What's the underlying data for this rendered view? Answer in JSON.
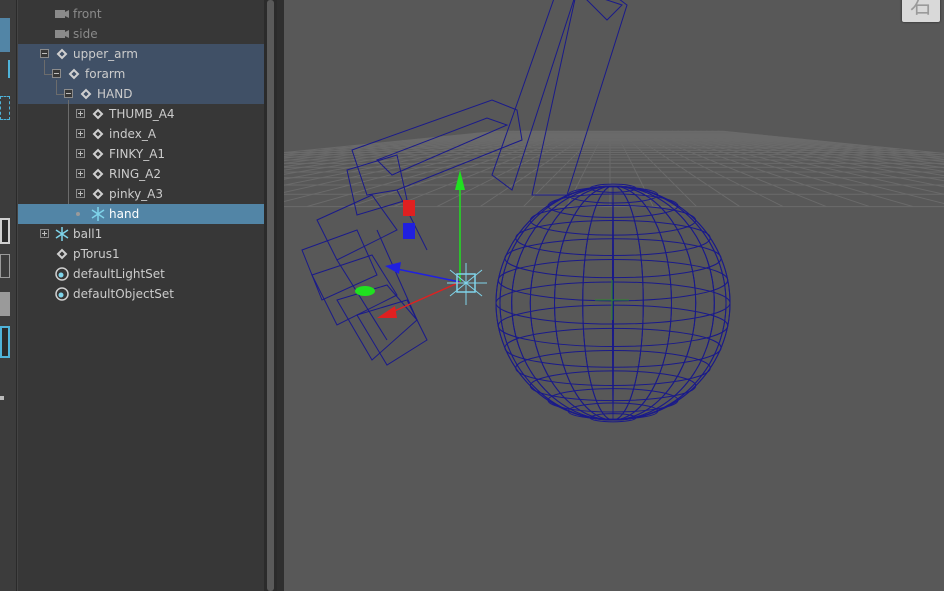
{
  "outliner": {
    "items": [
      {
        "label": "front",
        "icon": "camera-icon"
      },
      {
        "label": "side",
        "icon": "camera-icon"
      },
      {
        "label": "upper_arm",
        "icon": "joint-icon"
      },
      {
        "label": "forarm",
        "icon": "joint-icon"
      },
      {
        "label": "HAND",
        "icon": "joint-icon"
      },
      {
        "label": "THUMB_A4",
        "icon": "joint-icon"
      },
      {
        "label": "index_A",
        "icon": "joint-icon"
      },
      {
        "label": "FINKY_A1",
        "icon": "joint-icon"
      },
      {
        "label": "RING_A2",
        "icon": "joint-icon"
      },
      {
        "label": "pinky_A3",
        "icon": "joint-icon"
      },
      {
        "label": "hand",
        "icon": "ik-handle-icon"
      },
      {
        "label": "ball1",
        "icon": "ik-handle-icon"
      },
      {
        "label": "pTorus1",
        "icon": "joint-icon"
      },
      {
        "label": "defaultLightSet",
        "icon": "set-icon"
      },
      {
        "label": "defaultObjectSet",
        "icon": "set-icon"
      }
    ]
  },
  "viewport": {
    "viewcube_label": "右",
    "wire_color": "#1a1a8a",
    "grid_color": "#6a6a6a",
    "axis_colors": {
      "x": "#e02020",
      "y": "#20e020",
      "z": "#2020e0"
    },
    "selection_color": "#5285a6"
  }
}
